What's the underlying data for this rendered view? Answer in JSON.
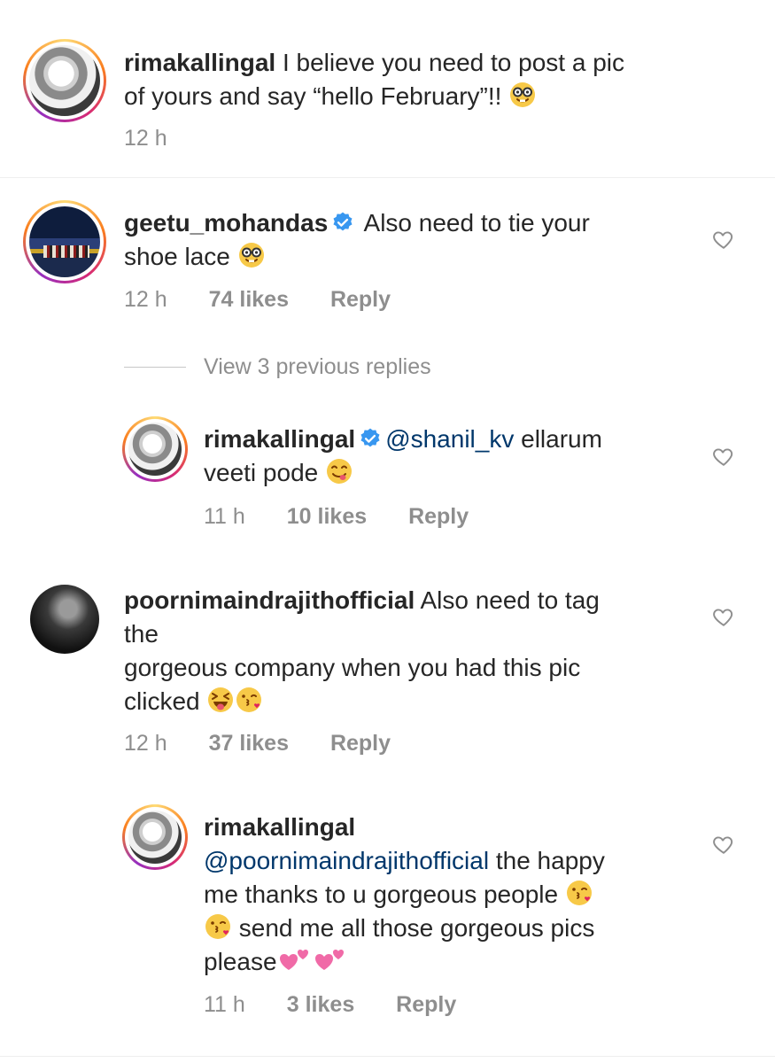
{
  "caption": {
    "username": "rimakallingal",
    "line1": " I believe you need to post a pic",
    "line2": "of yours and say “hello February”!! ",
    "time": "12 h"
  },
  "comment1": {
    "username": "geetu_mohandas",
    "text_line1": " Also need to tie your",
    "text_line2": "shoe lace ",
    "time": "12 h",
    "likes": "74 likes",
    "reply": "Reply",
    "view_replies": "View 3 previous replies"
  },
  "reply1": {
    "username": "rimakallingal",
    "mention": "@shanil_kv",
    "text_line1": " ellarum",
    "text_line2": "veeti pode ",
    "time": "11 h",
    "likes": "10 likes",
    "reply": "Reply"
  },
  "comment2": {
    "username": "poornimaindrajithofficial",
    "text_line1": " Also need to tag",
    "text_line2": "the",
    "text_line3": "gorgeous company when you had this pic",
    "text_line4": "clicked ",
    "time": "12 h",
    "likes": "37 likes",
    "reply": "Reply"
  },
  "reply2": {
    "username": "rimakallingal",
    "mention": "@poornimaindrajithofficial",
    "text_line1": " the happy",
    "text_line2": "me thanks to u gorgeous people ",
    "text_line3": " send me all those gorgeous pics",
    "text_line4": "please",
    "time": "11 h",
    "likes": "3 likes",
    "reply": "Reply"
  },
  "icons": {
    "heart": "heart-outline-icon",
    "verified": "verified-badge-icon",
    "emoji_sunglasses": "nerd-face-emoji",
    "emoji_yum": "yum-face-emoji",
    "emoji_tongue": "squinting-tongue-emoji",
    "emoji_kiss": "face-blowing-kiss-emoji",
    "emoji_hearts": "two-hearts-emoji"
  },
  "colors": {
    "text": "#262626",
    "meta": "#8e8e8e",
    "mention": "#00376b",
    "verified": "#3897f0"
  }
}
